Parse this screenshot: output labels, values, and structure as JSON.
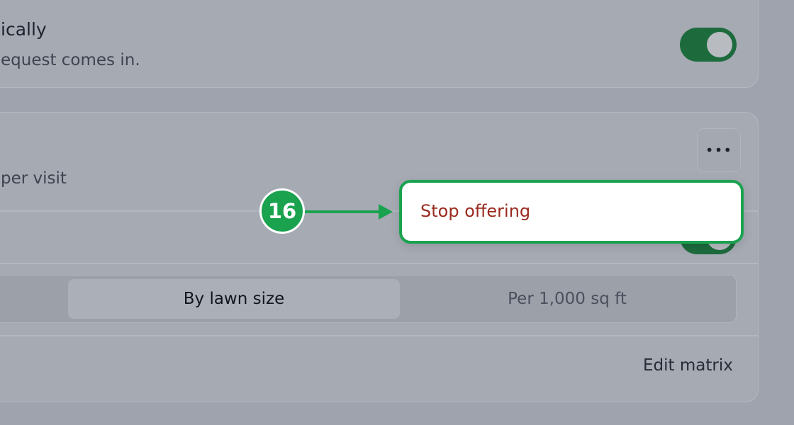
{
  "top_card": {
    "title": "ically",
    "subtitle": "equest comes in.",
    "toggle_on": true
  },
  "service_card": {
    "price_text": "per visit",
    "more_label": "•••",
    "pricing_mode": {
      "options": [
        "By lawn size",
        "Per 1,000 sq ft"
      ],
      "selected": "By lawn size"
    },
    "edit_link": "Edit matrix"
  },
  "annotation": {
    "step_number": "16",
    "menu_item": "Stop offering",
    "accent_color": "#1aa24f",
    "danger_color": "#9a2a1f"
  }
}
